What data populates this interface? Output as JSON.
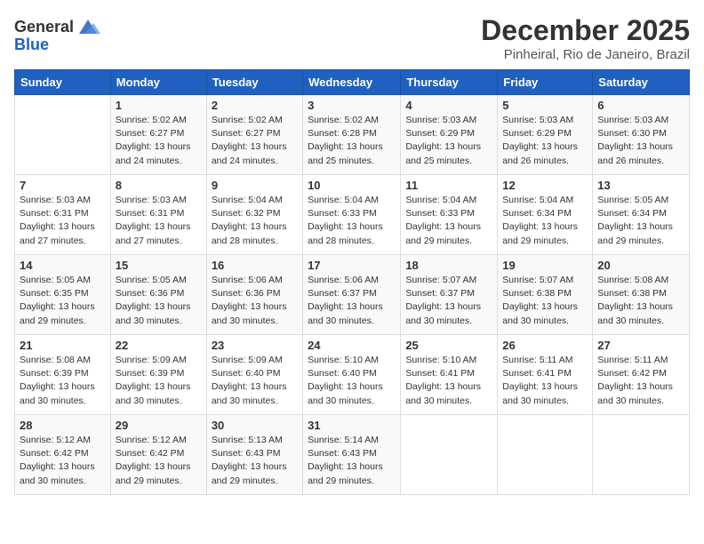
{
  "logo": {
    "general": "General",
    "blue": "Blue"
  },
  "header": {
    "month": "December 2025",
    "location": "Pinheiral, Rio de Janeiro, Brazil"
  },
  "weekdays": [
    "Sunday",
    "Monday",
    "Tuesday",
    "Wednesday",
    "Thursday",
    "Friday",
    "Saturday"
  ],
  "weeks": [
    [
      {
        "day": "",
        "sunrise": "",
        "sunset": "",
        "daylight": ""
      },
      {
        "day": "1",
        "sunrise": "Sunrise: 5:02 AM",
        "sunset": "Sunset: 6:27 PM",
        "daylight": "Daylight: 13 hours and 24 minutes."
      },
      {
        "day": "2",
        "sunrise": "Sunrise: 5:02 AM",
        "sunset": "Sunset: 6:27 PM",
        "daylight": "Daylight: 13 hours and 24 minutes."
      },
      {
        "day": "3",
        "sunrise": "Sunrise: 5:02 AM",
        "sunset": "Sunset: 6:28 PM",
        "daylight": "Daylight: 13 hours and 25 minutes."
      },
      {
        "day": "4",
        "sunrise": "Sunrise: 5:03 AM",
        "sunset": "Sunset: 6:29 PM",
        "daylight": "Daylight: 13 hours and 25 minutes."
      },
      {
        "day": "5",
        "sunrise": "Sunrise: 5:03 AM",
        "sunset": "Sunset: 6:29 PM",
        "daylight": "Daylight: 13 hours and 26 minutes."
      },
      {
        "day": "6",
        "sunrise": "Sunrise: 5:03 AM",
        "sunset": "Sunset: 6:30 PM",
        "daylight": "Daylight: 13 hours and 26 minutes."
      }
    ],
    [
      {
        "day": "7",
        "sunrise": "Sunrise: 5:03 AM",
        "sunset": "Sunset: 6:31 PM",
        "daylight": "Daylight: 13 hours and 27 minutes."
      },
      {
        "day": "8",
        "sunrise": "Sunrise: 5:03 AM",
        "sunset": "Sunset: 6:31 PM",
        "daylight": "Daylight: 13 hours and 27 minutes."
      },
      {
        "day": "9",
        "sunrise": "Sunrise: 5:04 AM",
        "sunset": "Sunset: 6:32 PM",
        "daylight": "Daylight: 13 hours and 28 minutes."
      },
      {
        "day": "10",
        "sunrise": "Sunrise: 5:04 AM",
        "sunset": "Sunset: 6:33 PM",
        "daylight": "Daylight: 13 hours and 28 minutes."
      },
      {
        "day": "11",
        "sunrise": "Sunrise: 5:04 AM",
        "sunset": "Sunset: 6:33 PM",
        "daylight": "Daylight: 13 hours and 29 minutes."
      },
      {
        "day": "12",
        "sunrise": "Sunrise: 5:04 AM",
        "sunset": "Sunset: 6:34 PM",
        "daylight": "Daylight: 13 hours and 29 minutes."
      },
      {
        "day": "13",
        "sunrise": "Sunrise: 5:05 AM",
        "sunset": "Sunset: 6:34 PM",
        "daylight": "Daylight: 13 hours and 29 minutes."
      }
    ],
    [
      {
        "day": "14",
        "sunrise": "Sunrise: 5:05 AM",
        "sunset": "Sunset: 6:35 PM",
        "daylight": "Daylight: 13 hours and 29 minutes."
      },
      {
        "day": "15",
        "sunrise": "Sunrise: 5:05 AM",
        "sunset": "Sunset: 6:36 PM",
        "daylight": "Daylight: 13 hours and 30 minutes."
      },
      {
        "day": "16",
        "sunrise": "Sunrise: 5:06 AM",
        "sunset": "Sunset: 6:36 PM",
        "daylight": "Daylight: 13 hours and 30 minutes."
      },
      {
        "day": "17",
        "sunrise": "Sunrise: 5:06 AM",
        "sunset": "Sunset: 6:37 PM",
        "daylight": "Daylight: 13 hours and 30 minutes."
      },
      {
        "day": "18",
        "sunrise": "Sunrise: 5:07 AM",
        "sunset": "Sunset: 6:37 PM",
        "daylight": "Daylight: 13 hours and 30 minutes."
      },
      {
        "day": "19",
        "sunrise": "Sunrise: 5:07 AM",
        "sunset": "Sunset: 6:38 PM",
        "daylight": "Daylight: 13 hours and 30 minutes."
      },
      {
        "day": "20",
        "sunrise": "Sunrise: 5:08 AM",
        "sunset": "Sunset: 6:38 PM",
        "daylight": "Daylight: 13 hours and 30 minutes."
      }
    ],
    [
      {
        "day": "21",
        "sunrise": "Sunrise: 5:08 AM",
        "sunset": "Sunset: 6:39 PM",
        "daylight": "Daylight: 13 hours and 30 minutes."
      },
      {
        "day": "22",
        "sunrise": "Sunrise: 5:09 AM",
        "sunset": "Sunset: 6:39 PM",
        "daylight": "Daylight: 13 hours and 30 minutes."
      },
      {
        "day": "23",
        "sunrise": "Sunrise: 5:09 AM",
        "sunset": "Sunset: 6:40 PM",
        "daylight": "Daylight: 13 hours and 30 minutes."
      },
      {
        "day": "24",
        "sunrise": "Sunrise: 5:10 AM",
        "sunset": "Sunset: 6:40 PM",
        "daylight": "Daylight: 13 hours and 30 minutes."
      },
      {
        "day": "25",
        "sunrise": "Sunrise: 5:10 AM",
        "sunset": "Sunset: 6:41 PM",
        "daylight": "Daylight: 13 hours and 30 minutes."
      },
      {
        "day": "26",
        "sunrise": "Sunrise: 5:11 AM",
        "sunset": "Sunset: 6:41 PM",
        "daylight": "Daylight: 13 hours and 30 minutes."
      },
      {
        "day": "27",
        "sunrise": "Sunrise: 5:11 AM",
        "sunset": "Sunset: 6:42 PM",
        "daylight": "Daylight: 13 hours and 30 minutes."
      }
    ],
    [
      {
        "day": "28",
        "sunrise": "Sunrise: 5:12 AM",
        "sunset": "Sunset: 6:42 PM",
        "daylight": "Daylight: 13 hours and 30 minutes."
      },
      {
        "day": "29",
        "sunrise": "Sunrise: 5:12 AM",
        "sunset": "Sunset: 6:42 PM",
        "daylight": "Daylight: 13 hours and 29 minutes."
      },
      {
        "day": "30",
        "sunrise": "Sunrise: 5:13 AM",
        "sunset": "Sunset: 6:43 PM",
        "daylight": "Daylight: 13 hours and 29 minutes."
      },
      {
        "day": "31",
        "sunrise": "Sunrise: 5:14 AM",
        "sunset": "Sunset: 6:43 PM",
        "daylight": "Daylight: 13 hours and 29 minutes."
      },
      {
        "day": "",
        "sunrise": "",
        "sunset": "",
        "daylight": ""
      },
      {
        "day": "",
        "sunrise": "",
        "sunset": "",
        "daylight": ""
      },
      {
        "day": "",
        "sunrise": "",
        "sunset": "",
        "daylight": ""
      }
    ]
  ]
}
